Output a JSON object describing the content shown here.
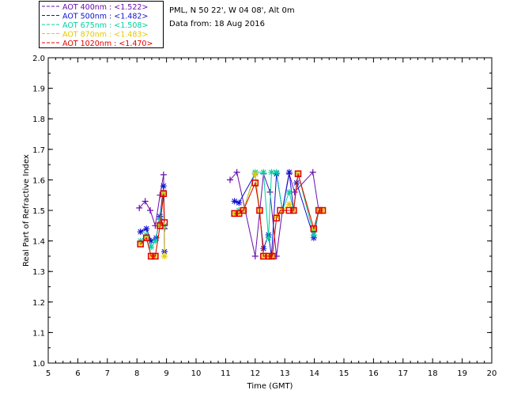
{
  "header": {
    "site": "PML, N 50 22', W 04 08', Alt 0m",
    "date": "Data from: 18 Aug 2016"
  },
  "chart_data": {
    "type": "line",
    "title": "",
    "xlabel": "Time (GMT)",
    "ylabel": "Real Part of Refractive Index",
    "xlim": [
      5,
      20
    ],
    "ylim": [
      1.0,
      2.0
    ],
    "x_ticks": [
      "5",
      "6",
      "7",
      "8",
      "9",
      "10",
      "11",
      "12",
      "13",
      "14",
      "15",
      "16",
      "17",
      "18",
      "19",
      "20"
    ],
    "y_ticks": [
      "1.0",
      "1.1",
      "1.2",
      "1.3",
      "1.4",
      "1.5",
      "1.6",
      "1.7",
      "1.8",
      "1.9",
      "2.0"
    ],
    "grid": false,
    "legend_placement": "top-left (outside plot)",
    "series": [
      {
        "name": "AOT  400nm : <1.522>",
        "color": "#6a0dad",
        "marker": "plus",
        "x": [
          8.08,
          8.28,
          8.45,
          8.62,
          8.78,
          8.9,
          8.93,
          11.15,
          11.38,
          12.0,
          12.28,
          12.5,
          12.72,
          12.92,
          13.15,
          13.33,
          13.95,
          14.15
        ],
        "y": [
          1.508,
          1.53,
          1.5,
          1.45,
          1.55,
          1.617,
          1.44,
          1.6,
          1.625,
          1.35,
          1.62,
          1.56,
          1.35,
          1.5,
          1.62,
          1.56,
          1.625,
          1.5
        ]
      },
      {
        "name": "AOT  500nm : <1.482>",
        "color": "#1010d0",
        "marker": "star",
        "x": [
          8.12,
          8.32,
          8.48,
          8.65,
          8.78,
          8.9,
          8.93,
          11.3,
          11.45,
          12.0,
          12.28,
          12.45,
          12.55,
          12.72,
          12.92,
          13.15,
          13.3,
          13.4,
          13.98,
          14.15
        ],
        "y": [
          1.43,
          1.44,
          1.4,
          1.41,
          1.48,
          1.58,
          1.365,
          1.53,
          1.525,
          1.62,
          1.375,
          1.42,
          1.35,
          1.62,
          1.5,
          1.625,
          1.5,
          1.59,
          1.41,
          1.5
        ]
      },
      {
        "name": "AOT  675nm : <1.508>",
        "color": "#00d0a0",
        "marker": "star",
        "x": [
          8.12,
          8.32,
          8.48,
          8.62,
          8.78,
          8.9,
          8.93,
          11.3,
          11.45,
          11.6,
          12.0,
          12.28,
          12.45,
          12.55,
          12.72,
          12.92,
          13.15,
          13.3,
          13.45,
          13.98,
          14.15,
          14.28
        ],
        "y": [
          1.4,
          1.42,
          1.38,
          1.4,
          1.47,
          1.56,
          1.45,
          1.49,
          1.5,
          1.5,
          1.625,
          1.625,
          1.41,
          1.625,
          1.625,
          1.5,
          1.56,
          1.5,
          1.62,
          1.42,
          1.5,
          1.5
        ]
      },
      {
        "name": "AOT  870nm : <1.483>",
        "color": "#e6c800",
        "marker": "star",
        "x": [
          8.12,
          8.32,
          8.48,
          8.62,
          8.78,
          8.9,
          8.93,
          11.3,
          11.45,
          11.6,
          12.0,
          12.15,
          12.28,
          12.45,
          12.58,
          12.72,
          12.92,
          13.15,
          13.3,
          13.45,
          13.98,
          14.15,
          14.28
        ],
        "y": [
          1.39,
          1.41,
          1.35,
          1.35,
          1.45,
          1.555,
          1.35,
          1.49,
          1.49,
          1.5,
          1.62,
          1.5,
          1.35,
          1.35,
          1.35,
          1.48,
          1.5,
          1.52,
          1.5,
          1.62,
          1.44,
          1.5,
          1.5
        ]
      },
      {
        "name": "AOT 1020nm : <1.470>",
        "color": "#e00000",
        "marker": "square",
        "x": [
          8.12,
          8.32,
          8.48,
          8.62,
          8.78,
          8.9,
          8.93,
          11.3,
          11.45,
          11.6,
          12.0,
          12.15,
          12.28,
          12.45,
          12.58,
          12.72,
          12.85,
          13.15,
          13.3,
          13.45,
          13.98,
          14.15,
          14.28
        ],
        "y": [
          1.39,
          1.41,
          1.35,
          1.35,
          1.45,
          1.555,
          1.46,
          1.49,
          1.49,
          1.5,
          1.59,
          1.5,
          1.35,
          1.35,
          1.35,
          1.475,
          1.5,
          1.5,
          1.5,
          1.62,
          1.44,
          1.5,
          1.5
        ]
      }
    ]
  }
}
